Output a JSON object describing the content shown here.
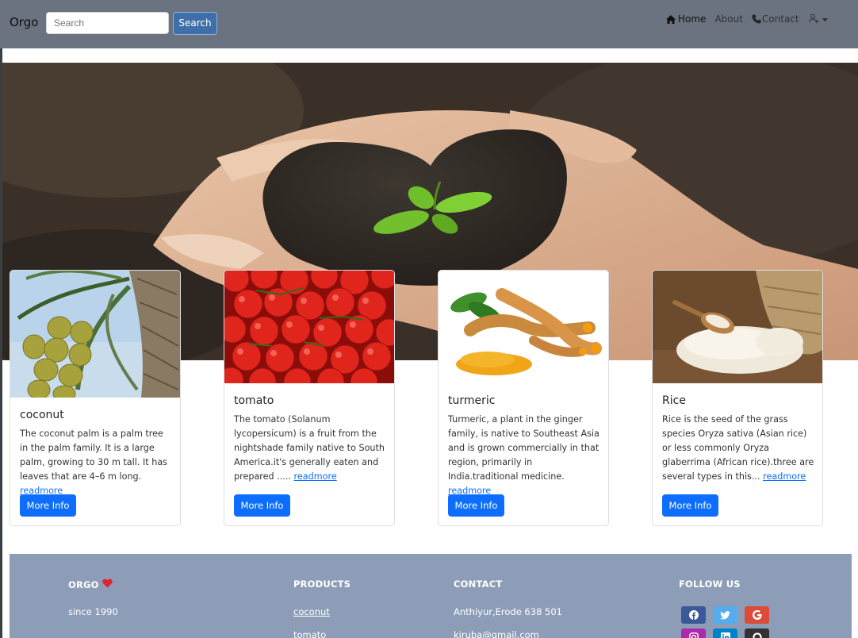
{
  "navbar": {
    "brand": "Orgo",
    "search_placeholder": "Search",
    "search_button": "Search",
    "links": {
      "home": "Home",
      "about": "About",
      "contact": "Contact"
    }
  },
  "cards": [
    {
      "title": "coconut",
      "text": "The coconut palm is a palm tree in the palm family. It is a large palm, growing to 30 m tall. It has leaves that are 4–6 m long.",
      "link": "readmore",
      "button": "More Info"
    },
    {
      "title": "tomato",
      "text": "The tomato (Solanum lycopersicum) is a fruit from the nightshade family native to South America.it's generally eaten and prepared .....",
      "link": "readmore",
      "button": "More Info"
    },
    {
      "title": "turmeric",
      "text": "Turmeric, a plant in the ginger family, is native to Southeast Asia and is grown commercially in that region, primarily in India.traditional medicine.",
      "link": "readmore",
      "button": "More Info"
    },
    {
      "title": "Rice",
      "text": "Rice is the seed of the grass species Oryza sativa (Asian rice) or less commonly Oryza glaberrima (African rice).three are several types in this...",
      "link": "readmore",
      "button": "More Info"
    }
  ],
  "footer": {
    "brand": "ORGO",
    "since": "since 1990",
    "products_heading": "PRODUCTS",
    "products": [
      "coconut",
      "tomato"
    ],
    "contact_heading": "CONTACT",
    "address": "Anthiyur,Erode 638 501",
    "email": "kiruba@gmail.com",
    "follow_heading": "FOLLOW US",
    "social": [
      "facebook",
      "twitter",
      "google",
      "instagram",
      "linkedin",
      "github"
    ]
  },
  "colors": {
    "navbar": "#6b7380",
    "primary": "#0d6efd",
    "footer": "#8d9db8",
    "heart": "#e0242b"
  }
}
